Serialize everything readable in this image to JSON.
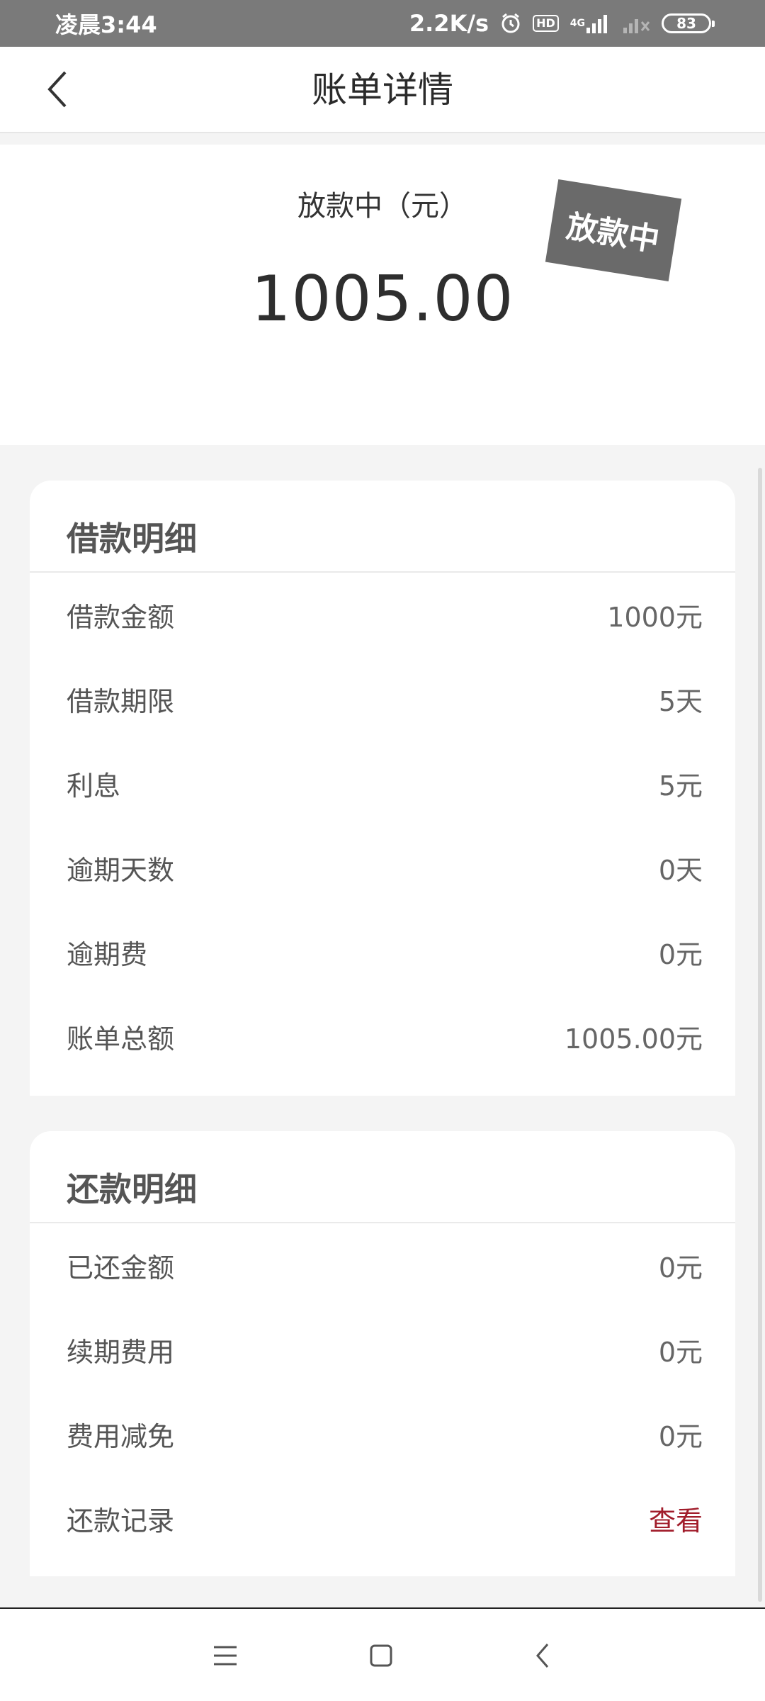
{
  "status_bar": {
    "time": "凌晨3:44",
    "net_speed": "2.2K/s",
    "hd_label": "HD",
    "network_type": "4G",
    "battery_level": "83",
    "icons": [
      "alarm-icon",
      "hd-icon",
      "signal-icon",
      "signal-empty-icon",
      "battery-icon"
    ]
  },
  "header": {
    "title": "账单详情",
    "back_icon": "chevron-left-icon"
  },
  "summary": {
    "label": "放款中（元）",
    "amount": "1005.00",
    "status_stamp": "放款中"
  },
  "loan_details": {
    "title": "借款明细",
    "rows": [
      {
        "label": "借款金额",
        "value": "1000元"
      },
      {
        "label": "借款期限",
        "value": "5天"
      },
      {
        "label": "利息",
        "value": "5元"
      },
      {
        "label": "逾期天数",
        "value": "0天"
      },
      {
        "label": "逾期费",
        "value": "0元"
      },
      {
        "label": "账单总额",
        "value": "1005.00元"
      }
    ]
  },
  "repayment_details": {
    "title": "还款明细",
    "rows": [
      {
        "label": "已还金额",
        "value": "0元"
      },
      {
        "label": "续期费用",
        "value": "0元"
      },
      {
        "label": "费用减免",
        "value": "0元"
      }
    ],
    "record": {
      "label": "还款记录",
      "link": "查看"
    }
  },
  "colors": {
    "status_bar_bg": "#7a7a7a",
    "stamp_bg": "#6a6a6a",
    "link": "#a11d2b",
    "page_bg": "#f4f4f4"
  },
  "system_nav": {
    "icons": [
      "menu-icon",
      "home-icon",
      "back-icon"
    ]
  }
}
